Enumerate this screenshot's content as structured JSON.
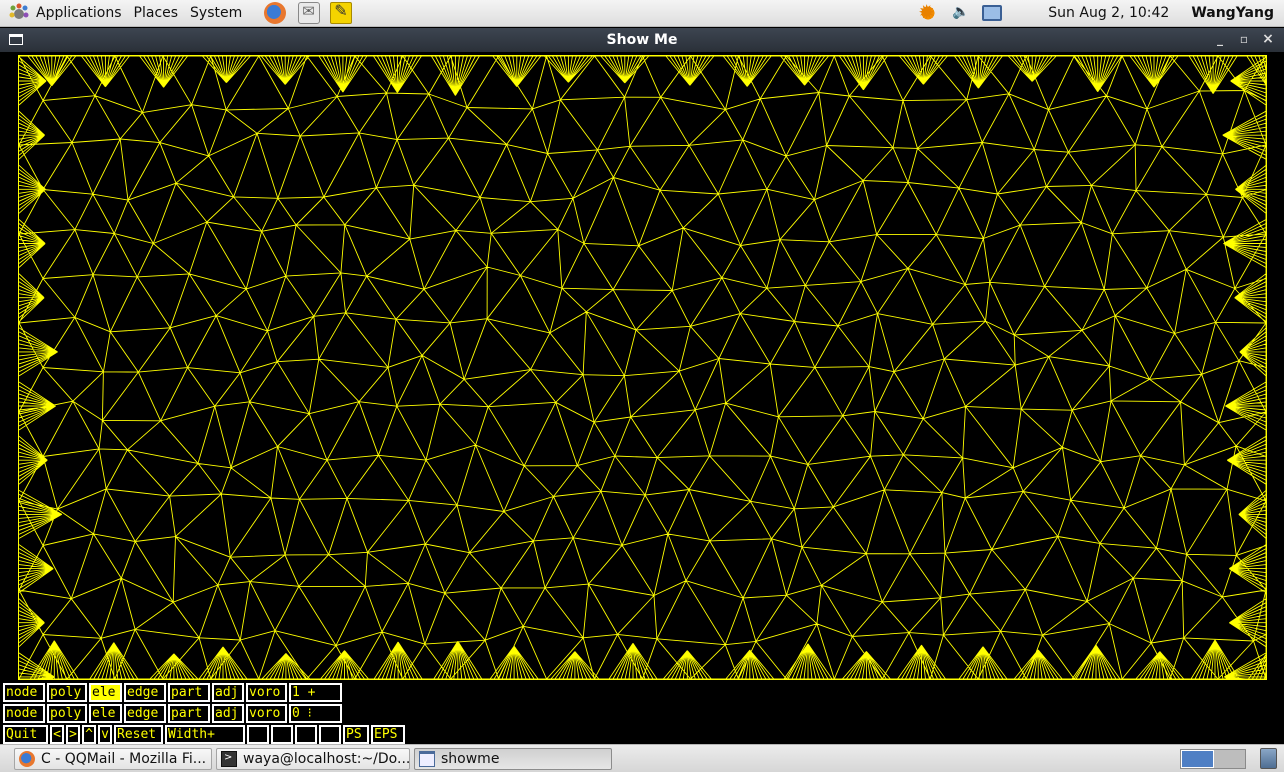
{
  "top_panel": {
    "menus": [
      "Applications",
      "Places",
      "System"
    ],
    "clock": "Sun Aug  2, 10:42",
    "user": "WangYang"
  },
  "window": {
    "title": "Show Me",
    "minimize": "_",
    "maximize": "▫",
    "close": "×"
  },
  "controls": {
    "row1": [
      "node",
      "poly",
      "ele",
      "edge",
      "part",
      "adj",
      "voro",
      "1    +"
    ],
    "row2": [
      "node",
      "poly",
      "ele",
      "edge",
      "part",
      "adj",
      "voro",
      "0    ⁝"
    ],
    "row3": [
      "Quit",
      "<",
      ">",
      "^",
      "v",
      "Reset",
      "Width+",
      "",
      "",
      "",
      "",
      "PS",
      "EPS"
    ],
    "active": "row1.ele"
  },
  "taskbar": {
    "tasks": [
      "C - QQMail - Mozilla Fi...",
      "waya@localhost:~/Do...",
      "showme"
    ]
  },
  "colors": {
    "mesh": "#ffff00",
    "canvas": "#000000",
    "titlebar": "#2f353e"
  },
  "icons": [
    "gnome-foot-icon",
    "firefox-icon",
    "mail-icon",
    "notes-icon",
    "weather-icon",
    "volume-icon",
    "network-icon",
    "window-menu-icon",
    "terminal-icon",
    "workspace-switcher-icon",
    "trash-icon"
  ]
}
